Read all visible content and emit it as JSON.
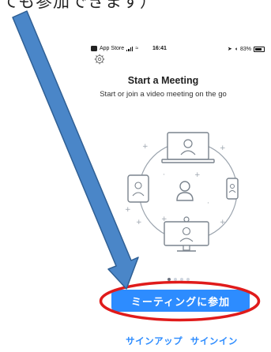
{
  "caption": {
    "text": "ても参加できます）"
  },
  "status_bar": {
    "carrier": "App Store",
    "time": "16:41",
    "battery_percent": "83%"
  },
  "settings": {
    "icon": "gear-icon"
  },
  "main": {
    "title": "Start a Meeting",
    "subtitle": "Start or join a video meeting on the go"
  },
  "pager": {
    "count": 4,
    "active_index": 0
  },
  "buttons": {
    "join_label": "ミーティングに参加"
  },
  "bottom_links": {
    "signup_label": "サインアップ",
    "signin_label": "サインイン"
  },
  "colors": {
    "accent": "#2d8cff",
    "annotation_arrow": "#4a86c8",
    "annotation_circle": "#e01b1b"
  }
}
